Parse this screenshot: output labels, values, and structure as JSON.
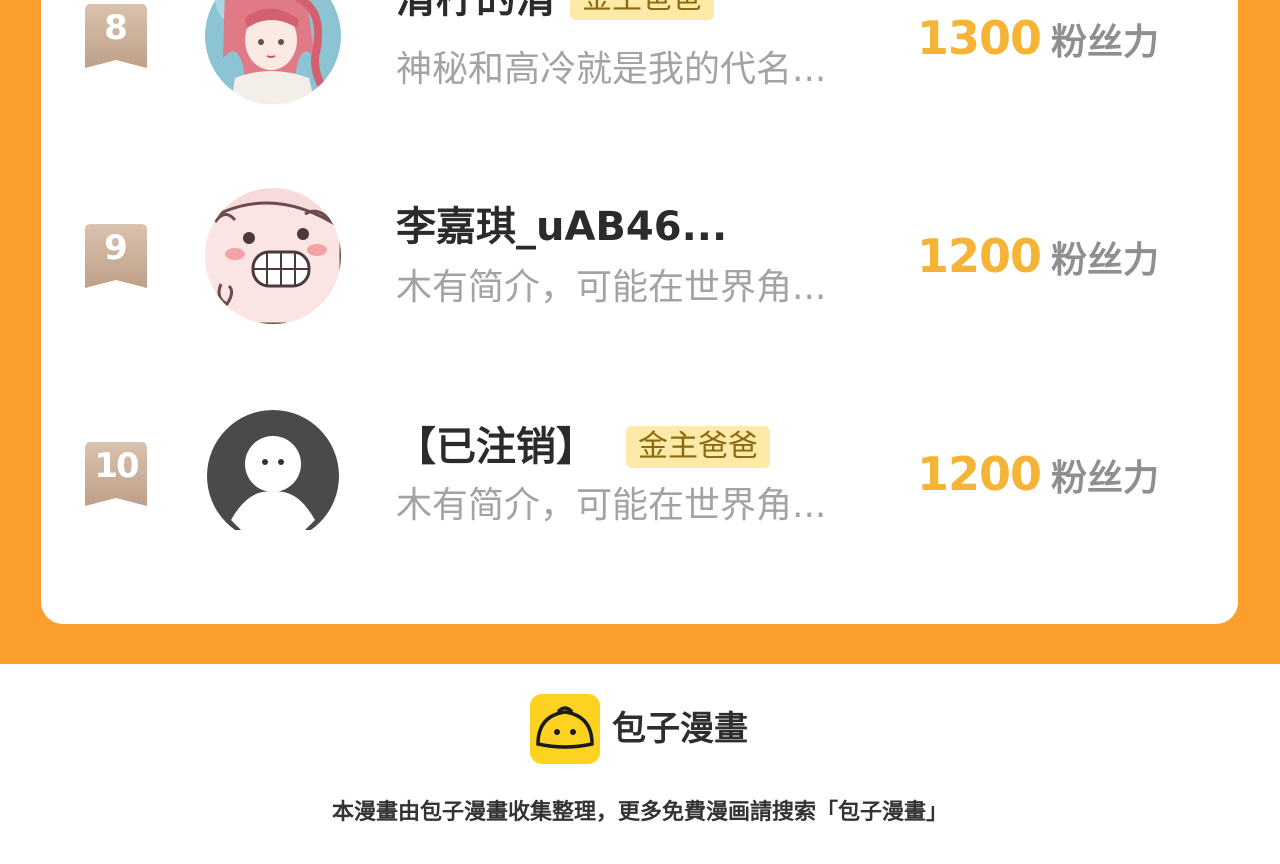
{
  "ranking": {
    "rows": [
      {
        "rank": "8",
        "name": "清柠的清",
        "tag": "金主爸爸",
        "bio": "神秘和高冷就是我的代名...",
        "fans": "1300",
        "fans_unit": "粉丝力",
        "avatar": "anime-girl-avatar"
      },
      {
        "rank": "9",
        "name": "李嘉琪_uAB46...",
        "tag": "",
        "bio": "木有简介，可能在世界角...",
        "fans": "1200",
        "fans_unit": "粉丝力",
        "avatar": "grinning-cartoon-avatar"
      },
      {
        "rank": "10",
        "name": "【已注销】",
        "tag": "金主爸爸",
        "bio": "木有简介，可能在世界角...",
        "fans": "1200",
        "fans_unit": "粉丝力",
        "avatar": "default-person-avatar"
      }
    ]
  },
  "footer": {
    "brand_name": "包子漫畫",
    "brand_icon": "bun-logo-icon",
    "notice": "本漫畫由包子漫畫收集整理，更多免費漫画請搜索「包子漫畫」"
  },
  "colors": {
    "panel_orange": "#fb9e2c",
    "fans_gold": "#f5b435",
    "tag_bg": "#fdeaa6",
    "badge_tan": "#c9ad97",
    "logo_yellow": "#fed220"
  }
}
